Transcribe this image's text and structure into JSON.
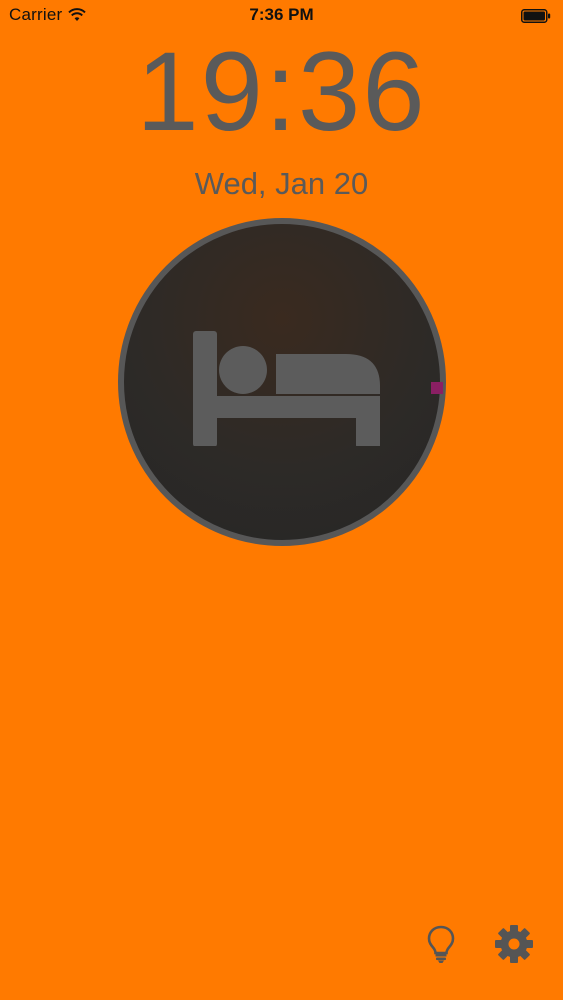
{
  "status_bar": {
    "carrier": "Carrier",
    "time": "7:36 PM",
    "icons": [
      "wifi-icon",
      "battery-icon"
    ]
  },
  "clock": {
    "time": "19:36",
    "date": "Wed, Jan 20"
  },
  "sleep_button": {
    "icon": "bed-icon"
  },
  "bottom_bar": {
    "icons": [
      "lightbulb-icon",
      "gear-icon"
    ]
  },
  "colors": {
    "background": "#FF7A00",
    "text": "#5A5A5A",
    "circle_fill": "#2D2A27",
    "circle_border": "#575757",
    "marker": "#8A1F63"
  }
}
